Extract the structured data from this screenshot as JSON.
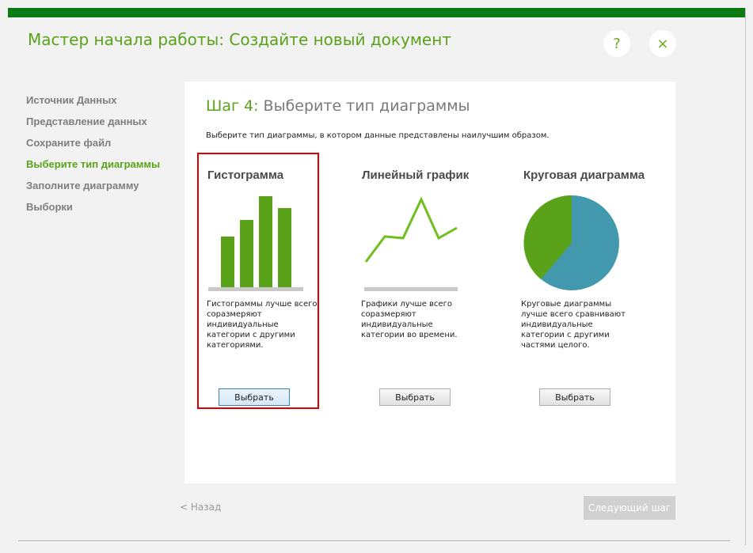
{
  "window": {
    "title": "Мастер начала работы: Создайте новый документ",
    "help_symbol": "?",
    "close_symbol": "×",
    "accent_color": "#5aa21a",
    "topbar_color": "#0c7a12"
  },
  "sidebar": {
    "items": [
      {
        "label": "Источник Данных",
        "active": false
      },
      {
        "label": "Представление данных",
        "active": false
      },
      {
        "label": "Сохраните файл",
        "active": false
      },
      {
        "label": "Выберите тип диаграммы",
        "active": true
      },
      {
        "label": "Заполните диаграмму",
        "active": false
      },
      {
        "label": "Выборки",
        "active": false
      }
    ]
  },
  "main": {
    "step_number": "Шаг 4:",
    "step_title": "Выберите тип диаграммы",
    "description": "Выберите тип диаграммы, в котором данные представлены наилучшим образом.",
    "cards": [
      {
        "title": "Гистограмма",
        "icon": "bar-chart-icon",
        "text": "Гистограммы лучше всего соразмеряют индивидуальные категории с другими категориями.",
        "button": "Выбрать",
        "selected": true
      },
      {
        "title": "Линейный график",
        "icon": "line-chart-icon",
        "text": "Графики лучше всего соразмеряют индивидуальные категории во времени.",
        "button": "Выбрать",
        "selected": false
      },
      {
        "title": "Круговая диаграмма",
        "icon": "pie-chart-icon",
        "text": "Круговые диаграммы лучше всего сравнивают индивидуальные категории с другими частями целого.",
        "button": "Выбрать",
        "selected": false
      }
    ]
  },
  "footer": {
    "back_label": "< Назад",
    "next_label": "Следующий шаг"
  }
}
